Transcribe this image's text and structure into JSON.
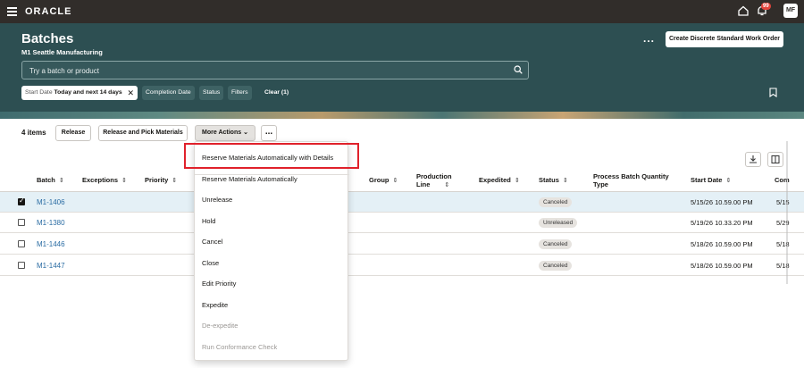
{
  "app": {
    "logo": "ORACLE",
    "avatar_initials": "MF",
    "notification_count": "99"
  },
  "header": {
    "title": "Batches",
    "subtitle": "M1 Seattle Manufacturing",
    "more_label": "...",
    "create_button": "Create Discrete Standard Work Order",
    "search_placeholder": "Try a batch or product",
    "filters": {
      "start_date_label": "Start Date",
      "start_date_value": "Today and next 14 days",
      "completion_date": "Completion Date",
      "status": "Status",
      "filters": "Filters",
      "clear": "Clear (1)"
    }
  },
  "toolbar": {
    "count": "4 items",
    "release": "Release",
    "release_pick": "Release and Pick Materials",
    "more_actions": "More Actions",
    "overflow": "..."
  },
  "table": {
    "columns": {
      "batch": "Batch",
      "exceptions": "Exceptions",
      "priority": "Priority",
      "group": "Group",
      "production_line_1": "Production",
      "production_line_2": "Line",
      "expedited": "Expedited",
      "status": "Status",
      "process_qty_1": "Process Batch Quantity",
      "process_qty_2": "Type",
      "start_date": "Start Date",
      "completion_date": "Com"
    },
    "rows": [
      {
        "batch": "M1-1406",
        "status": "Canceled",
        "start_date": "5/15/26 10.59.00 PM",
        "completion": "5/15",
        "selected": true
      },
      {
        "batch": "M1-1380",
        "status": "Unreleased",
        "start_date": "5/19/26 10.33.20 PM",
        "completion": "5/29",
        "selected": false
      },
      {
        "batch": "M1-1446",
        "status": "Canceled",
        "start_date": "5/18/26 10.59.00 PM",
        "completion": "5/18",
        "selected": false
      },
      {
        "batch": "M1-1447",
        "status": "Canceled",
        "start_date": "5/18/26 10.59.00 PM",
        "completion": "5/18",
        "selected": false
      }
    ]
  },
  "menu": {
    "items": [
      {
        "label": "Reserve Materials Automatically with Details",
        "disabled": false
      },
      {
        "label": "Reserve Materials Automatically",
        "disabled": false
      },
      {
        "label": "Unrelease",
        "disabled": false
      },
      {
        "label": "Hold",
        "disabled": false
      },
      {
        "label": "Cancel",
        "disabled": false
      },
      {
        "label": "Close",
        "disabled": false
      },
      {
        "label": "Edit Priority",
        "disabled": false
      },
      {
        "label": "Expedite",
        "disabled": false
      },
      {
        "label": "De-expedite",
        "disabled": true
      },
      {
        "label": "Run Conformance Check",
        "disabled": true
      }
    ]
  },
  "colors": {
    "header_bg": "#2d4f52",
    "topbar_bg": "#312d2a",
    "highlight": "#e0212b",
    "link": "#2a6ca3"
  }
}
